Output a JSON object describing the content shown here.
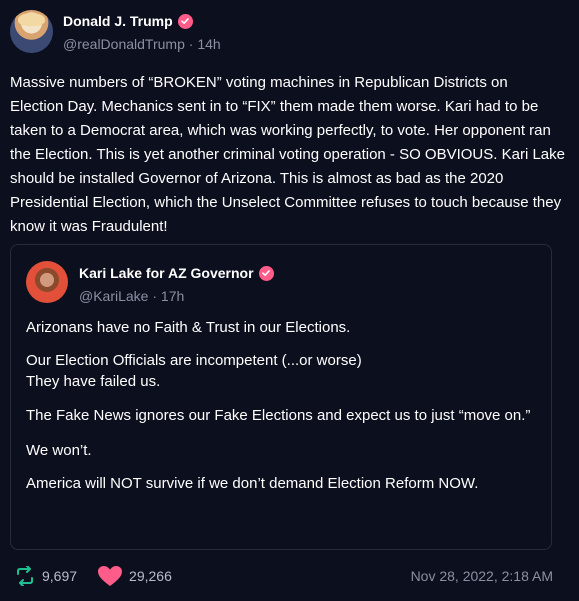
{
  "post": {
    "author": {
      "display_name": "Donald J. Trump",
      "handle": "@realDonaldTrump",
      "time": "14h"
    },
    "text": "Massive numbers of “BROKEN” voting machines in Republican Districts on Election Day. Mechanics sent in to “FIX” them made them worse. Kari had to be taken to a Democrat area, which was working perfectly, to vote. Her opponent ran the Election. This is yet another criminal voting operation - SO OBVIOUS. Kari Lake should be installed Governor of Arizona. This is almost as bad as the 2020 Presidential Election, which the Unselect Committee refuses to touch because they know it was Fraudulent!",
    "quote": {
      "author": {
        "display_name": "Kari Lake for AZ Governor",
        "handle": "@KariLake",
        "time": "17h"
      },
      "paragraphs": [
        "Arizonans have no Faith & Trust in our Elections.",
        "Our Election Officials are incompetent (...or worse)",
        "They have failed us.",
        "The Fake News ignores our Fake Elections and expect us to just “move on.”",
        "We won’t.",
        "America will NOT survive if we don’t demand Election Reform NOW."
      ]
    },
    "stats": {
      "restruths": "9,697",
      "likes": "29,266"
    },
    "timestamp": "Nov 28, 2022, 2:18 AM"
  },
  "colors": {
    "background": "#0c0f1d",
    "verified": "#ff5c8a",
    "restruth": "#1fbf8f",
    "like": "#ff5c8a",
    "muted": "#8a8fa3"
  },
  "icons": {
    "verified": "verified-badge-icon",
    "restruth": "restruth-icon",
    "like": "heart-icon"
  }
}
